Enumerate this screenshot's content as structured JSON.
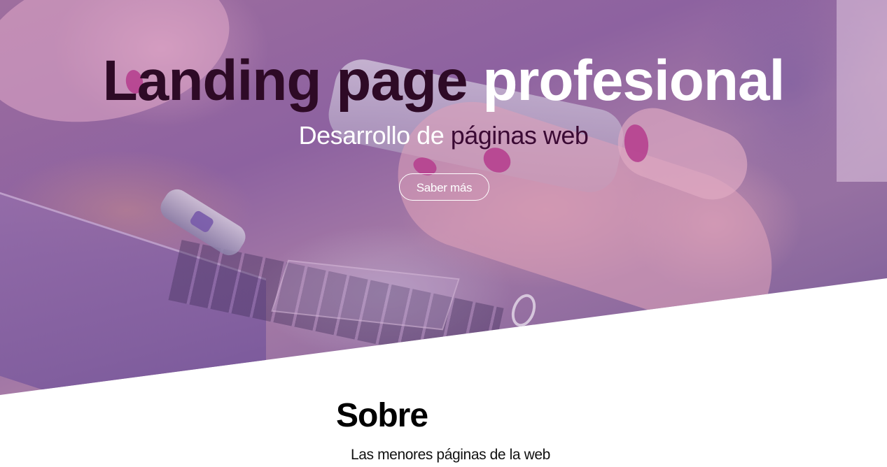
{
  "hero": {
    "title_part1": "Landing page",
    "title_part2": "profesional",
    "subtitle_part1": "Desarrollo de",
    "subtitle_part2": "páginas web",
    "cta_label": "Saber más",
    "background_image": "woman-hand-holding-smartphone-over-laptop",
    "overlay_color": "#8d62a0"
  },
  "about": {
    "title": "Sobre",
    "text": "Las menores páginas de la web"
  },
  "colors": {
    "title_dark": "#2e0a26",
    "title_light": "#ffffff",
    "subtitle_dark": "#3b0a34",
    "page_background": "#ffffff"
  }
}
